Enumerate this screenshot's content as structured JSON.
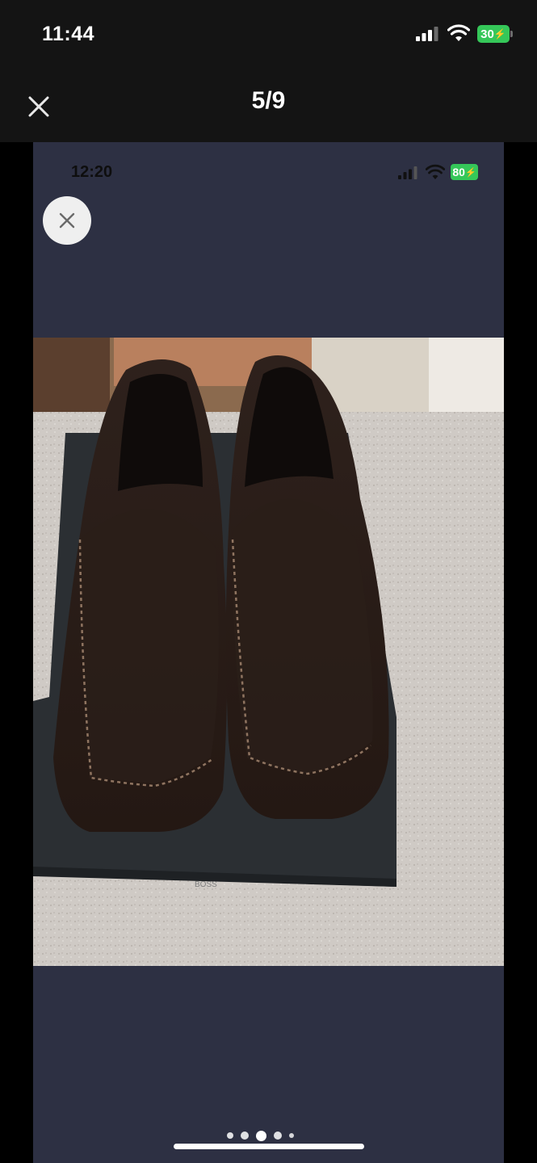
{
  "status_bar": {
    "time": "11:44",
    "battery": "30",
    "icons": [
      "cellular-signal-icon",
      "wifi-icon",
      "battery-charging-icon"
    ]
  },
  "viewer": {
    "counter": "5/9",
    "close_icon": "close-icon"
  },
  "inner_screenshot": {
    "time": "12:20",
    "battery": "80",
    "close_icon": "close-icon",
    "photo": "brown-suede-loafers-on-shoe-box",
    "box_brand": "BOSS",
    "pagination": {
      "count": 5,
      "active_index": 2
    }
  },
  "colors": {
    "background": "#000000",
    "header": "#141414",
    "panel": "#2d3043",
    "battery": "#35c759"
  }
}
